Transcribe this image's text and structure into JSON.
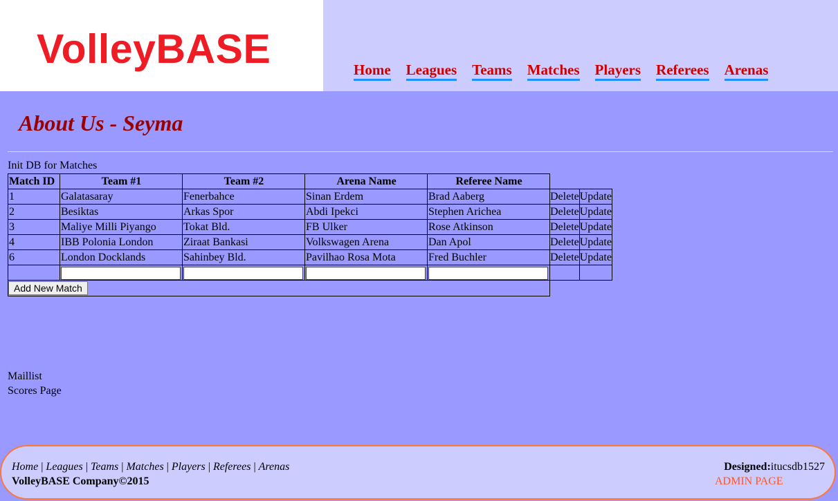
{
  "header": {
    "logo_text": "VolleyBASE",
    "nav": [
      "Home",
      "Leagues",
      "Teams",
      "Matches",
      "Players",
      "Referees",
      "Arenas"
    ]
  },
  "main": {
    "title": "About Us - Seyma",
    "init_link": "Init DB for Matches",
    "table": {
      "headers": [
        "Match ID",
        "Team #1",
        "Team #2",
        "Arena Name",
        "Referee Name"
      ],
      "rows": [
        {
          "id": "1",
          "team1": "Galatasaray",
          "team2": "Fenerbahce",
          "arena": "Sinan Erdem",
          "referee": "Brad Aaberg"
        },
        {
          "id": "2",
          "team1": "Besiktas",
          "team2": "Arkas Spor",
          "arena": "Abdi Ipekci",
          "referee": "Stephen Arichea"
        },
        {
          "id": "3",
          "team1": "Maliye Milli Piyango",
          "team2": "Tokat Bld.",
          "arena": "FB Ulker",
          "referee": "Rose Atkinson"
        },
        {
          "id": "4",
          "team1": "IBB Polonia London",
          "team2": "Ziraat Bankasi",
          "arena": "Volkswagen Arena",
          "referee": "Dan Apol"
        },
        {
          "id": "6",
          "team1": "London Docklands",
          "team2": "Sahinbey Bld.",
          "arena": "Pavilhao Rosa Mota",
          "referee": "Fred Buchler"
        }
      ],
      "delete_label": "Delete",
      "update_label": "Update",
      "add_button": "Add New Match"
    },
    "maillist": "Maillist",
    "scores": "Scores Page"
  },
  "footer": {
    "links": [
      "Home",
      "Leagues",
      "Teams",
      "Matches",
      "Players",
      "Referees",
      "Arenas"
    ],
    "copyright": "VolleyBASE Company©2015",
    "designed_label": "Designed:",
    "designed_value": "itucsdb1527",
    "admin": "ADMIN PAGE"
  }
}
